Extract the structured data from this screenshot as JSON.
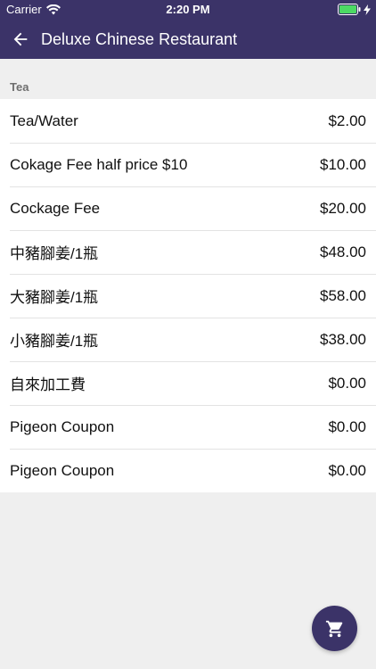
{
  "status_bar": {
    "carrier": "Carrier",
    "time": "2:20 PM",
    "wifi_icon": "wifi-icon",
    "battery_icon": "battery-icon",
    "charging_icon": "charging-bolt-icon",
    "battery_color": "#4cd964"
  },
  "app_bar": {
    "title": "Deluxe Chinese Restaurant",
    "back_icon": "arrow-left-icon",
    "background": "#3b3368"
  },
  "section": {
    "title": "Tea"
  },
  "items": [
    {
      "name": "Tea/Water",
      "price": "$2.00"
    },
    {
      "name": "Cokage Fee half price $10",
      "price": "$10.00"
    },
    {
      "name": "Cockage Fee",
      "price": "$20.00"
    },
    {
      "name": "中豬腳姜/1瓶",
      "price": "$48.00"
    },
    {
      "name": "大豬腳姜/1瓶",
      "price": "$58.00"
    },
    {
      "name": "小豬腳姜/1瓶",
      "price": "$38.00"
    },
    {
      "name": "自來加工費",
      "price": "$0.00"
    },
    {
      "name": "Pigeon Coupon",
      "price": "$0.00"
    },
    {
      "name": "Pigeon Coupon",
      "price": "$0.00"
    }
  ],
  "cart_button": {
    "icon": "shopping-cart-icon"
  }
}
